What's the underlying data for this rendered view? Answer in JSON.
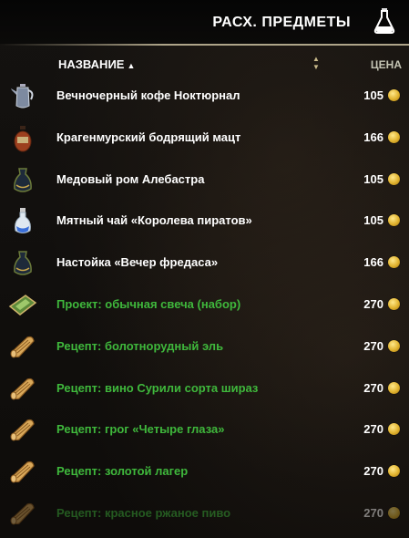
{
  "header": {
    "title": "РАСХ. ПРЕДМЕТЫ",
    "icon": "potion-icon"
  },
  "columns": {
    "name": "НАЗВАНИЕ",
    "price": "ЦЕНА"
  },
  "items": [
    {
      "name": "Вечночерный кофе Ноктюрнал",
      "price": "105",
      "type": "drink",
      "icon": "coffee-pot-icon"
    },
    {
      "name": "Крагенмурский бодрящий мацт",
      "price": "166",
      "type": "drink",
      "icon": "clay-jug-icon"
    },
    {
      "name": "Медовый ром Алебастра",
      "price": "105",
      "type": "drink",
      "icon": "dark-bottle-icon"
    },
    {
      "name": "Мятный чай «Королева пиратов»",
      "price": "105",
      "type": "drink",
      "icon": "flask-icon"
    },
    {
      "name": "Настойка «Вечер фредаса»",
      "price": "166",
      "type": "drink",
      "icon": "dark-bottle-icon"
    },
    {
      "name": "Проект: обычная свеча (набор)",
      "price": "270",
      "type": "recipe",
      "icon": "blueprint-icon"
    },
    {
      "name": "Рецепт: болотнорудный эль",
      "price": "270",
      "type": "recipe",
      "icon": "scroll-icon"
    },
    {
      "name": "Рецепт: вино Сурили сорта шираз",
      "price": "270",
      "type": "recipe",
      "icon": "scroll-icon"
    },
    {
      "name": "Рецепт: грог «Четыре глаза»",
      "price": "270",
      "type": "recipe",
      "icon": "scroll-icon"
    },
    {
      "name": "Рецепт: золотой лагер",
      "price": "270",
      "type": "recipe",
      "icon": "scroll-icon"
    },
    {
      "name": "Рецепт: красное ржаное пиво",
      "price": "270",
      "type": "recipe",
      "icon": "scroll-icon"
    }
  ]
}
